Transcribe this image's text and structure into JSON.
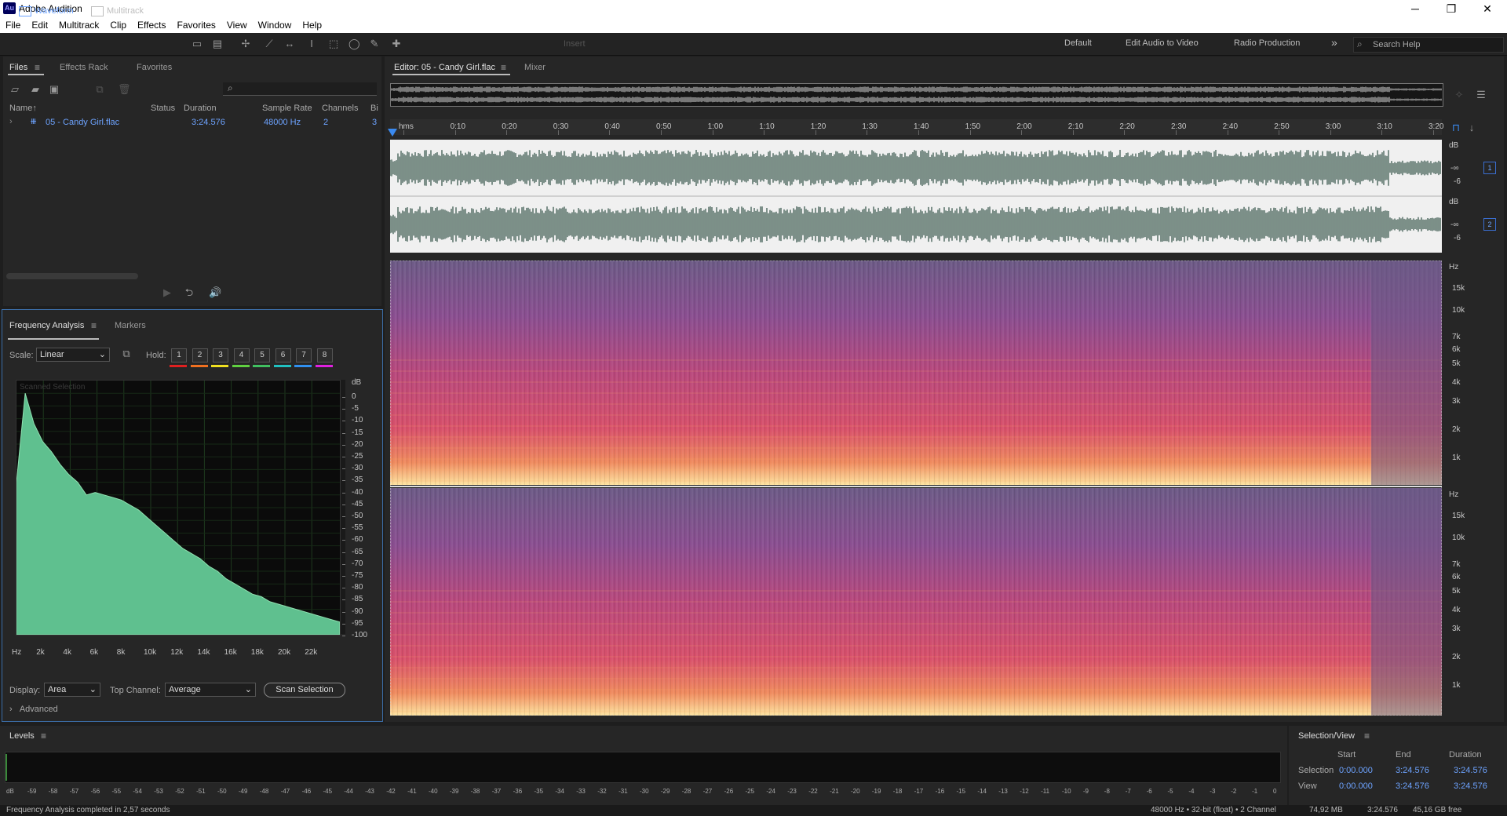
{
  "window": {
    "title": "Adobe Audition",
    "app_badge": "Au",
    "minimize": "─",
    "restore": "❐",
    "close": "✕"
  },
  "menu": [
    "File",
    "Edit",
    "Multitrack",
    "Clip",
    "Effects",
    "Favorites",
    "View",
    "Window",
    "Help"
  ],
  "toolbar": {
    "waveform_label": "Waveform",
    "multitrack_label": "Multitrack",
    "insert_label": "Insert",
    "workspaces": [
      "Default",
      "Edit Audio to Video",
      "Radio Production"
    ],
    "more_glyph": "»",
    "search_placeholder": "Search Help"
  },
  "files_panel": {
    "tabs": [
      "Files",
      "Effects Rack",
      "Favorites"
    ],
    "menu_glyph": "≡",
    "search_glyph": "⌕",
    "columns": [
      "Name",
      "Status",
      "Duration",
      "Sample Rate",
      "Channels",
      "Bi"
    ],
    "sort_glyph": "↑",
    "file": {
      "name": "05 - Candy Girl.flac",
      "status": "",
      "duration": "3:24.576",
      "sample_rate": "48000 Hz",
      "channels": "2",
      "bits": "3"
    }
  },
  "freq_panel": {
    "tabs": [
      "Frequency Analysis",
      "Markers"
    ],
    "scale_label": "Scale:",
    "scale_value": "Linear",
    "hold_label": "Hold:",
    "hold_buttons": [
      "1",
      "2",
      "3",
      "4",
      "5",
      "6",
      "7",
      "8"
    ],
    "hold_colors": [
      "#e02020",
      "#f07020",
      "#f0e020",
      "#60d040",
      "#40c060",
      "#20c0c0",
      "#3090f0",
      "#e020e0"
    ],
    "overlay_text": "Scanned Selection",
    "db_unit": "dB",
    "db_ticks": [
      "0",
      "-5",
      "-10",
      "-15",
      "-20",
      "-25",
      "-30",
      "-35",
      "-40",
      "-45",
      "-50",
      "-55",
      "-60",
      "-65",
      "-70",
      "-75",
      "-80",
      "-85",
      "-90",
      "-95",
      "-100"
    ],
    "hz_ticks": [
      "Hz",
      "2k",
      "4k",
      "6k",
      "8k",
      "10k",
      "12k",
      "14k",
      "16k",
      "18k",
      "20k",
      "22k"
    ],
    "display_label": "Display:",
    "display_value": "Area",
    "top_channel_label": "Top Channel:",
    "top_channel_value": "Average",
    "scan_button": "Scan Selection",
    "advanced_label": "Advanced",
    "spectrum_color": "#5fc08f",
    "spectrum_db": [
      -40,
      -5,
      -17,
      -24,
      -28,
      -33,
      -37,
      -40,
      -45,
      -44,
      -45,
      -46,
      -47,
      -49,
      -51,
      -54,
      -57,
      -60,
      -63,
      -66,
      -68,
      -70,
      -73,
      -75,
      -78,
      -80,
      -82,
      -84,
      -85,
      -87,
      -88,
      -89,
      -90,
      -91,
      -92,
      -93,
      -94,
      -95
    ]
  },
  "editor": {
    "tabs": [
      "Editor: 05 - Candy Girl.flac",
      "Mixer"
    ],
    "ruler_labels": [
      "hms",
      "0:10",
      "0:20",
      "0:30",
      "0:40",
      "0:50",
      "1:00",
      "1:10",
      "1:20",
      "1:30",
      "1:40",
      "1:50",
      "2:00",
      "2:10",
      "2:20",
      "2:30",
      "2:40",
      "2:50",
      "3:00",
      "3:10",
      "3:20"
    ],
    "db_unit": "dB",
    "db_scale": [
      "-∞",
      "-6"
    ],
    "channel_badges": [
      "1",
      "2"
    ],
    "hz_unit": "Hz",
    "hz_scale": [
      "15k",
      "10k",
      "7k",
      "6k",
      "5k",
      "4k",
      "3k",
      "2k",
      "1k"
    ],
    "waveform_color": "#2f4f44"
  },
  "levels_panel": {
    "title": "Levels",
    "menu_glyph": "≡",
    "scale": [
      "dB",
      "-59",
      "-58",
      "-57",
      "-56",
      "-55",
      "-54",
      "-53",
      "-52",
      "-51",
      "-50",
      "-49",
      "-48",
      "-47",
      "-46",
      "-45",
      "-44",
      "-43",
      "-42",
      "-41",
      "-40",
      "-39",
      "-38",
      "-37",
      "-36",
      "-35",
      "-34",
      "-33",
      "-32",
      "-31",
      "-30",
      "-29",
      "-28",
      "-27",
      "-26",
      "-25",
      "-24",
      "-23",
      "-22",
      "-21",
      "-20",
      "-19",
      "-18",
      "-17",
      "-16",
      "-15",
      "-14",
      "-13",
      "-12",
      "-11",
      "-10",
      "-9",
      "-8",
      "-7",
      "-6",
      "-5",
      "-4",
      "-3",
      "-2",
      "-1",
      "0"
    ]
  },
  "selection_view": {
    "title": "Selection/View",
    "menu_glyph": "≡",
    "headers": [
      "Start",
      "End",
      "Duration"
    ],
    "rows": [
      {
        "label": "Selection",
        "start": "0:00.000",
        "end": "3:24.576",
        "duration": "3:24.576"
      },
      {
        "label": "View",
        "start": "0:00.000",
        "end": "3:24.576",
        "duration": "3:24.576"
      }
    ]
  },
  "status_bar": {
    "message": "Frequency Analysis completed in 2,57 seconds",
    "format": "48000 Hz • 32-bit (float) • 2 Channel",
    "size": "74,92 MB",
    "duration": "3:24.576",
    "free": "45,16 GB free"
  }
}
